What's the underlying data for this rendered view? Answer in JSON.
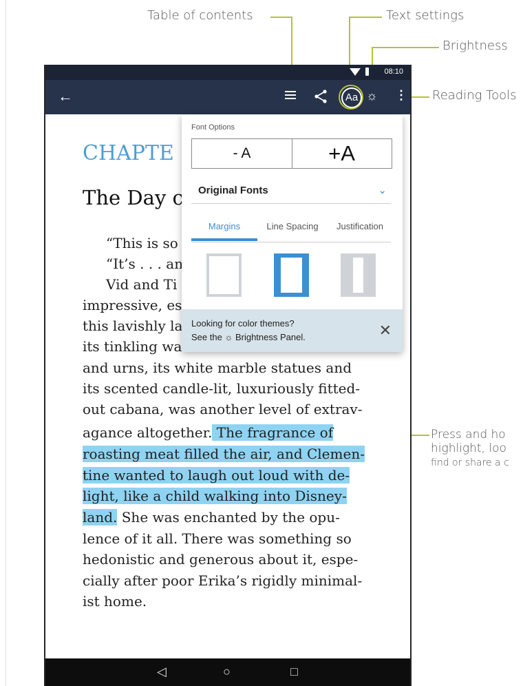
{
  "callouts": {
    "toc": "Table of contents",
    "text_settings": "Text settings",
    "brightness": "Brightness",
    "reading_tools": "Reading Tools",
    "highlight_1": "Press and ho",
    "highlight_2": "highlight, loo",
    "highlight_3": "find or share a c"
  },
  "status": {
    "time": "08:10"
  },
  "toolbar": {
    "back": "←",
    "text_settings": "Aa",
    "brightness": "☼",
    "more": "⋮"
  },
  "book": {
    "chapter": "CHAPTE",
    "title": "The Day c",
    "lines": [
      "“This is so",
      "“It’s . . . an",
      "Vid and Ti",
      "impressive, es",
      "this lavishly la",
      "its tinkling wa",
      "and urns, its white marble statues and",
      "its scented candle-lit, luxuriously fitted-",
      "out cabana, was another level of extrav-",
      "agance altogether.",
      "She was enchanted by the opu-",
      "lence of it all. There was something so",
      "hedonistic and generous about it, espe-",
      "cially after poor Erika’s rigidly minimal-",
      "ist home."
    ],
    "highlight": [
      " The fragrance of ",
      "roasting meat filled the air, and Clemen-",
      "tine wanted to laugh out loud with de-",
      "light, like a child walking into Disney-",
      "land."
    ]
  },
  "popup": {
    "title": "Font Options",
    "decrease": "- A",
    "increase": "+A",
    "font": "Original Fonts",
    "tabs": {
      "margins": "Margins",
      "spacing": "Line Spacing",
      "justification": "Justification"
    },
    "tip_line1": "Looking for color themes?",
    "tip_line2": "See the ☼ Brightness Panel.",
    "close": "✕"
  },
  "nav": {
    "back": "◁",
    "home": "○",
    "recents": "□"
  },
  "colors": {
    "accent": "#3b8ed3",
    "toolbar": "#27334a",
    "highlight": "#8fd3f2",
    "callout_line": "#b5c333",
    "chapter": "#4a9fd4"
  }
}
